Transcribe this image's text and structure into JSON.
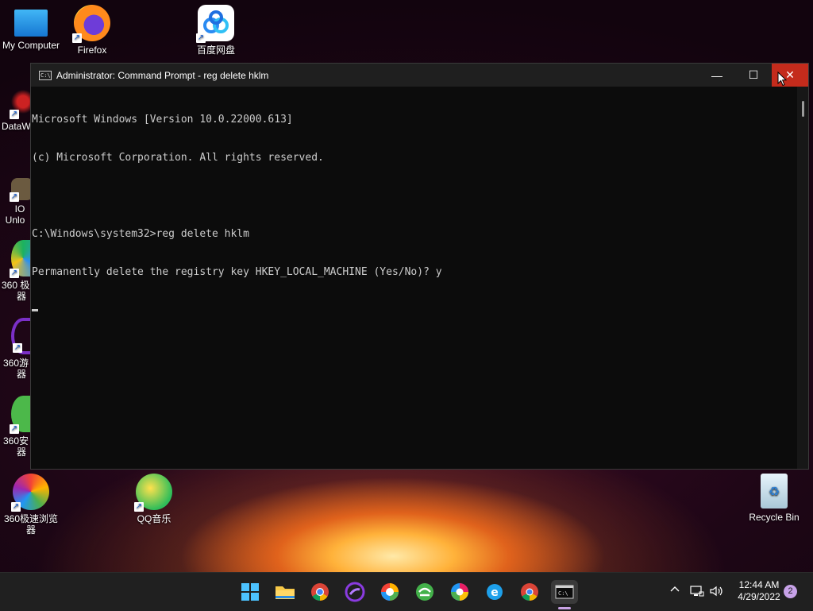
{
  "desktop": {
    "icons": [
      {
        "label": "My Computer"
      },
      {
        "label": "Firefox"
      },
      {
        "label": "百度网盘"
      },
      {
        "label": "DataW"
      },
      {
        "label": "IO"
      },
      {
        "label": "Unlo"
      },
      {
        "label": "360 极"
      },
      {
        "label": "器"
      },
      {
        "label": "360游"
      },
      {
        "label": "器"
      },
      {
        "label": "360安"
      },
      {
        "label": "器"
      },
      {
        "label": "360极速浏览"
      },
      {
        "label": "器"
      },
      {
        "label": "QQ音乐"
      },
      {
        "label": "Recycle Bin"
      }
    ]
  },
  "cmd_window": {
    "title": "Administrator: Command Prompt - reg  delete hklm",
    "icon_text": "C:\\",
    "minimize_symbol": "—",
    "maximize_symbol": "☐",
    "close_symbol": "✕",
    "lines": [
      "Microsoft Windows [Version 10.0.22000.613]",
      "(c) Microsoft Corporation. All rights reserved.",
      "",
      "C:\\Windows\\system32>reg delete hklm",
      "Permanently delete the registry key HKEY_LOCAL_MACHINE (Yes/No)? y"
    ]
  },
  "taskbar": {
    "icons": [
      "start-icon",
      "file-explorer-icon",
      "chrome-icon",
      "360-game-icon",
      "360-browser-icon",
      "360-safe-icon",
      "360-speed-browser-icon",
      "ie-icon",
      "chrome-2-icon",
      "terminal-icon"
    ],
    "tray": {
      "chevron": "^",
      "time": "12:44 AM",
      "date": "4/29/2022",
      "notification_count": "2"
    }
  },
  "colors": {
    "accent": "#c42b1c",
    "console_text": "#cccccc",
    "console_bg": "#0c0c0c",
    "taskbar_bg": "#202020"
  }
}
